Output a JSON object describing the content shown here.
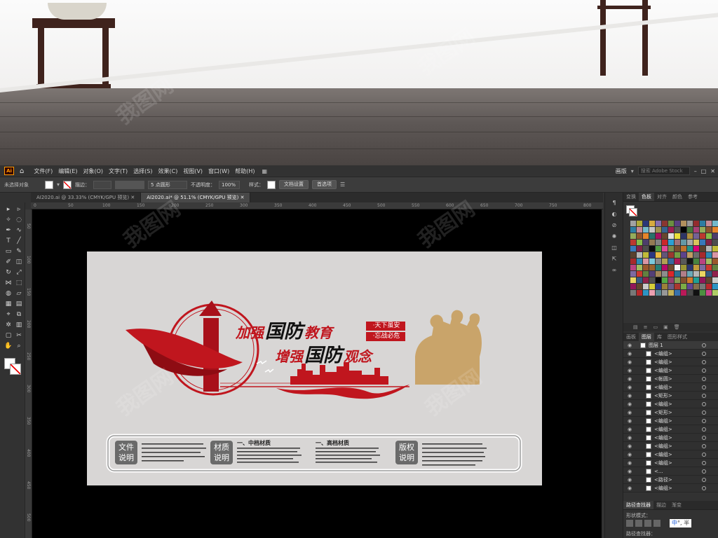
{
  "app": {
    "logo": "Ai",
    "menu": [
      "文件(F)",
      "编辑(E)",
      "对象(O)",
      "文字(T)",
      "选择(S)",
      "效果(C)",
      "视图(V)",
      "窗口(W)",
      "帮助(H)"
    ],
    "workspace": "画版",
    "search_placeholder": "搜索 Adobe Stock"
  },
  "controlbar": {
    "selection": "未选择对象",
    "stroke_label": "描边：",
    "brush": "5 点圆形",
    "opacity_label": "不透明度：",
    "opacity": "100%",
    "style_label": "样式：",
    "doc_setup": "文档设置",
    "prefs": "首选项"
  },
  "tabs": [
    {
      "label": "AI2020.ai @ 33.33% (CMYK/GPU 预览)",
      "active": false
    },
    {
      "label": "AI2020.ai* @ 51.1% (CMYK/GPU 预览)",
      "active": true
    }
  ],
  "ruler_h": [
    "0",
    "50",
    "100",
    "150",
    "200",
    "250",
    "300",
    "350",
    "400",
    "450",
    "500",
    "550",
    "600",
    "650",
    "700",
    "750",
    "800"
  ],
  "ruler_v": [
    "50",
    "100",
    "150",
    "200",
    "250",
    "300",
    "350",
    "400",
    "450",
    "500"
  ],
  "artwork": {
    "line1_a": "加强",
    "line1_b": "国防",
    "line1_c": "教育",
    "line2_a": "增强",
    "line2_b": "国防",
    "line2_c": "观念",
    "slogan1": "·天下虽安",
    "slogan2": "·忘战必危",
    "info_file": "文件说明",
    "info_material": "材质说明",
    "info_copyright": "版权说明",
    "mid_title": "一、中档材质",
    "high_title": "一、高档材质"
  },
  "panels": {
    "top_tabs": [
      "变换",
      "色板",
      "对齐",
      "颜色",
      "参考"
    ],
    "top_active": 1,
    "mid_tabs": [
      "画板",
      "图层",
      "库",
      "图形样式"
    ],
    "mid_active": 1,
    "bottom_tabs": [
      "路径查找器",
      "描边",
      "渐变"
    ],
    "bottom_active": 0,
    "shape_mode": "形状模式：",
    "pathfinder": "路径查找器：",
    "ime": "中",
    "ime_extra": "°, 半"
  },
  "layers": [
    {
      "name": "图层 1",
      "top": true
    },
    {
      "name": "<编组>"
    },
    {
      "name": "<编组>"
    },
    {
      "name": "<编组>"
    },
    {
      "name": "<帐圆>"
    },
    {
      "name": "<编组>"
    },
    {
      "name": "<矩形>"
    },
    {
      "name": "<编组>"
    },
    {
      "name": "<矩形>"
    },
    {
      "name": "<编组>"
    },
    {
      "name": "<编组>"
    },
    {
      "name": "<编组>"
    },
    {
      "name": "<编组>"
    },
    {
      "name": "<编组>"
    },
    {
      "name": "<编组>"
    },
    {
      "name": "<..."
    },
    {
      "name": "<路径>"
    },
    {
      "name": "<编组>"
    }
  ],
  "watermark": "我图网",
  "colors": {
    "accent_red": "#c0161e",
    "gold": "#c9a46a",
    "panel_bg": "#323232",
    "artboard": "#d8d6d5"
  }
}
